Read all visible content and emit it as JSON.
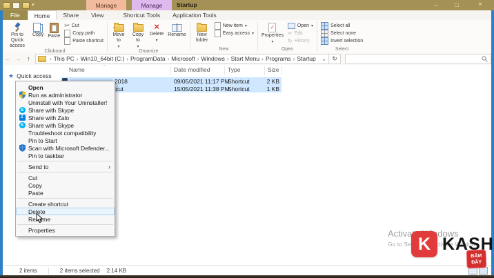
{
  "colors": {
    "titlebar": "#a39155",
    "context_tab_1_bg": "#f3bb9e",
    "context_tab_2_bg": "#ddb9ee",
    "selection_blue": "#cfe8ff",
    "window_border_blue": "#2e81c4",
    "brand_red": "#e23b3b",
    "badge_red": "#d32f2f",
    "skype_blue": "#00aff0",
    "zalo_blue": "#0180de"
  },
  "glyphs": {
    "dropdown": "▾",
    "submenu": "›",
    "sort_asc": "ˆ",
    "back": "←",
    "forward": "→",
    "up": "↑",
    "refresh": "↻",
    "chevron_down": "⌄",
    "star": "★",
    "check": "✓",
    "cut": "✂",
    "close": "×",
    "minimize": "–",
    "maximize": "□",
    "separator": "›",
    "skype_initial": "S",
    "zalo_initial": "Z"
  },
  "window": {
    "title": "Startup",
    "context_tab_1": "Manage",
    "context_tab_2": "Manage"
  },
  "tabs": {
    "file": "File",
    "items": [
      "Home",
      "Share",
      "View",
      "Shortcut Tools",
      "Application Tools"
    ]
  },
  "ribbon": {
    "clipboard": {
      "label": "Clipboard",
      "pin": "Pin to Quick access",
      "copy": "Copy",
      "paste": "Paste",
      "cut": "Cut",
      "copy_path": "Copy path",
      "paste_shortcut": "Paste shortcut"
    },
    "organize": {
      "label": "Organize",
      "move_to": "Move to",
      "copy_to": "Copy to",
      "delete": "Delete",
      "rename": "Rename"
    },
    "new": {
      "label": "New",
      "new_folder": "New folder",
      "new_item": "New item",
      "easy_access": "Easy access"
    },
    "open": {
      "label": "Open",
      "properties": "Properties",
      "open": "Open",
      "edit": "Edit",
      "history": "History"
    },
    "select": {
      "label": "Select",
      "select_all": "Select all",
      "select_none": "Select none",
      "invert": "Invert selection"
    }
  },
  "address": {
    "path": [
      "This PC",
      "Win10_64bit (C:)",
      "ProgramData",
      "Microsoft",
      "Windows",
      "Start Menu",
      "Programs",
      "Startup"
    ],
    "search_value": ""
  },
  "sidebar": {
    "quick_access": "Quick access"
  },
  "filelist": {
    "columns": [
      "Name",
      "Date modified",
      "Type",
      "Size"
    ],
    "rows": [
      {
        "name_visible": "2018",
        "date": "09/05/2021 11:17 PM",
        "type": "Shortcut",
        "size": "2 KB"
      },
      {
        "name_visible": "tcut",
        "date": "15/05/2021 11:38 PM",
        "type": "Shortcut",
        "size": "1 KB"
      }
    ]
  },
  "context_menu": {
    "items": [
      {
        "label": "Open"
      },
      {
        "label": "Run as administrator"
      },
      {
        "label": "Uninstall with Your Uninstaller!"
      },
      {
        "label": "Share with Skype"
      },
      {
        "label": "Share with Zalo"
      },
      {
        "label": "Share with Skype"
      },
      {
        "label": "Troubleshoot compatibility"
      },
      {
        "label": "Pin to Start"
      },
      {
        "label": "Scan with Microsoft Defender..."
      },
      {
        "label": "Pin to taskbar"
      },
      {
        "label": "Send to"
      },
      {
        "label": "Cut"
      },
      {
        "label": "Copy"
      },
      {
        "label": "Paste"
      },
      {
        "label": "Create shortcut"
      },
      {
        "label": "Delete"
      },
      {
        "label": "Rename"
      },
      {
        "label": "Properties"
      }
    ]
  },
  "status": {
    "count": "2 items",
    "selected": "2 items selected",
    "size": "2.14 KB"
  },
  "watermark": {
    "line1": "Activate Windows",
    "line2": "Go to Settings to activate Windows."
  },
  "brand": {
    "initial": "K",
    "name": "KASHI",
    "badge_line1": "BẤM",
    "badge_line2": "ĐÂY"
  }
}
